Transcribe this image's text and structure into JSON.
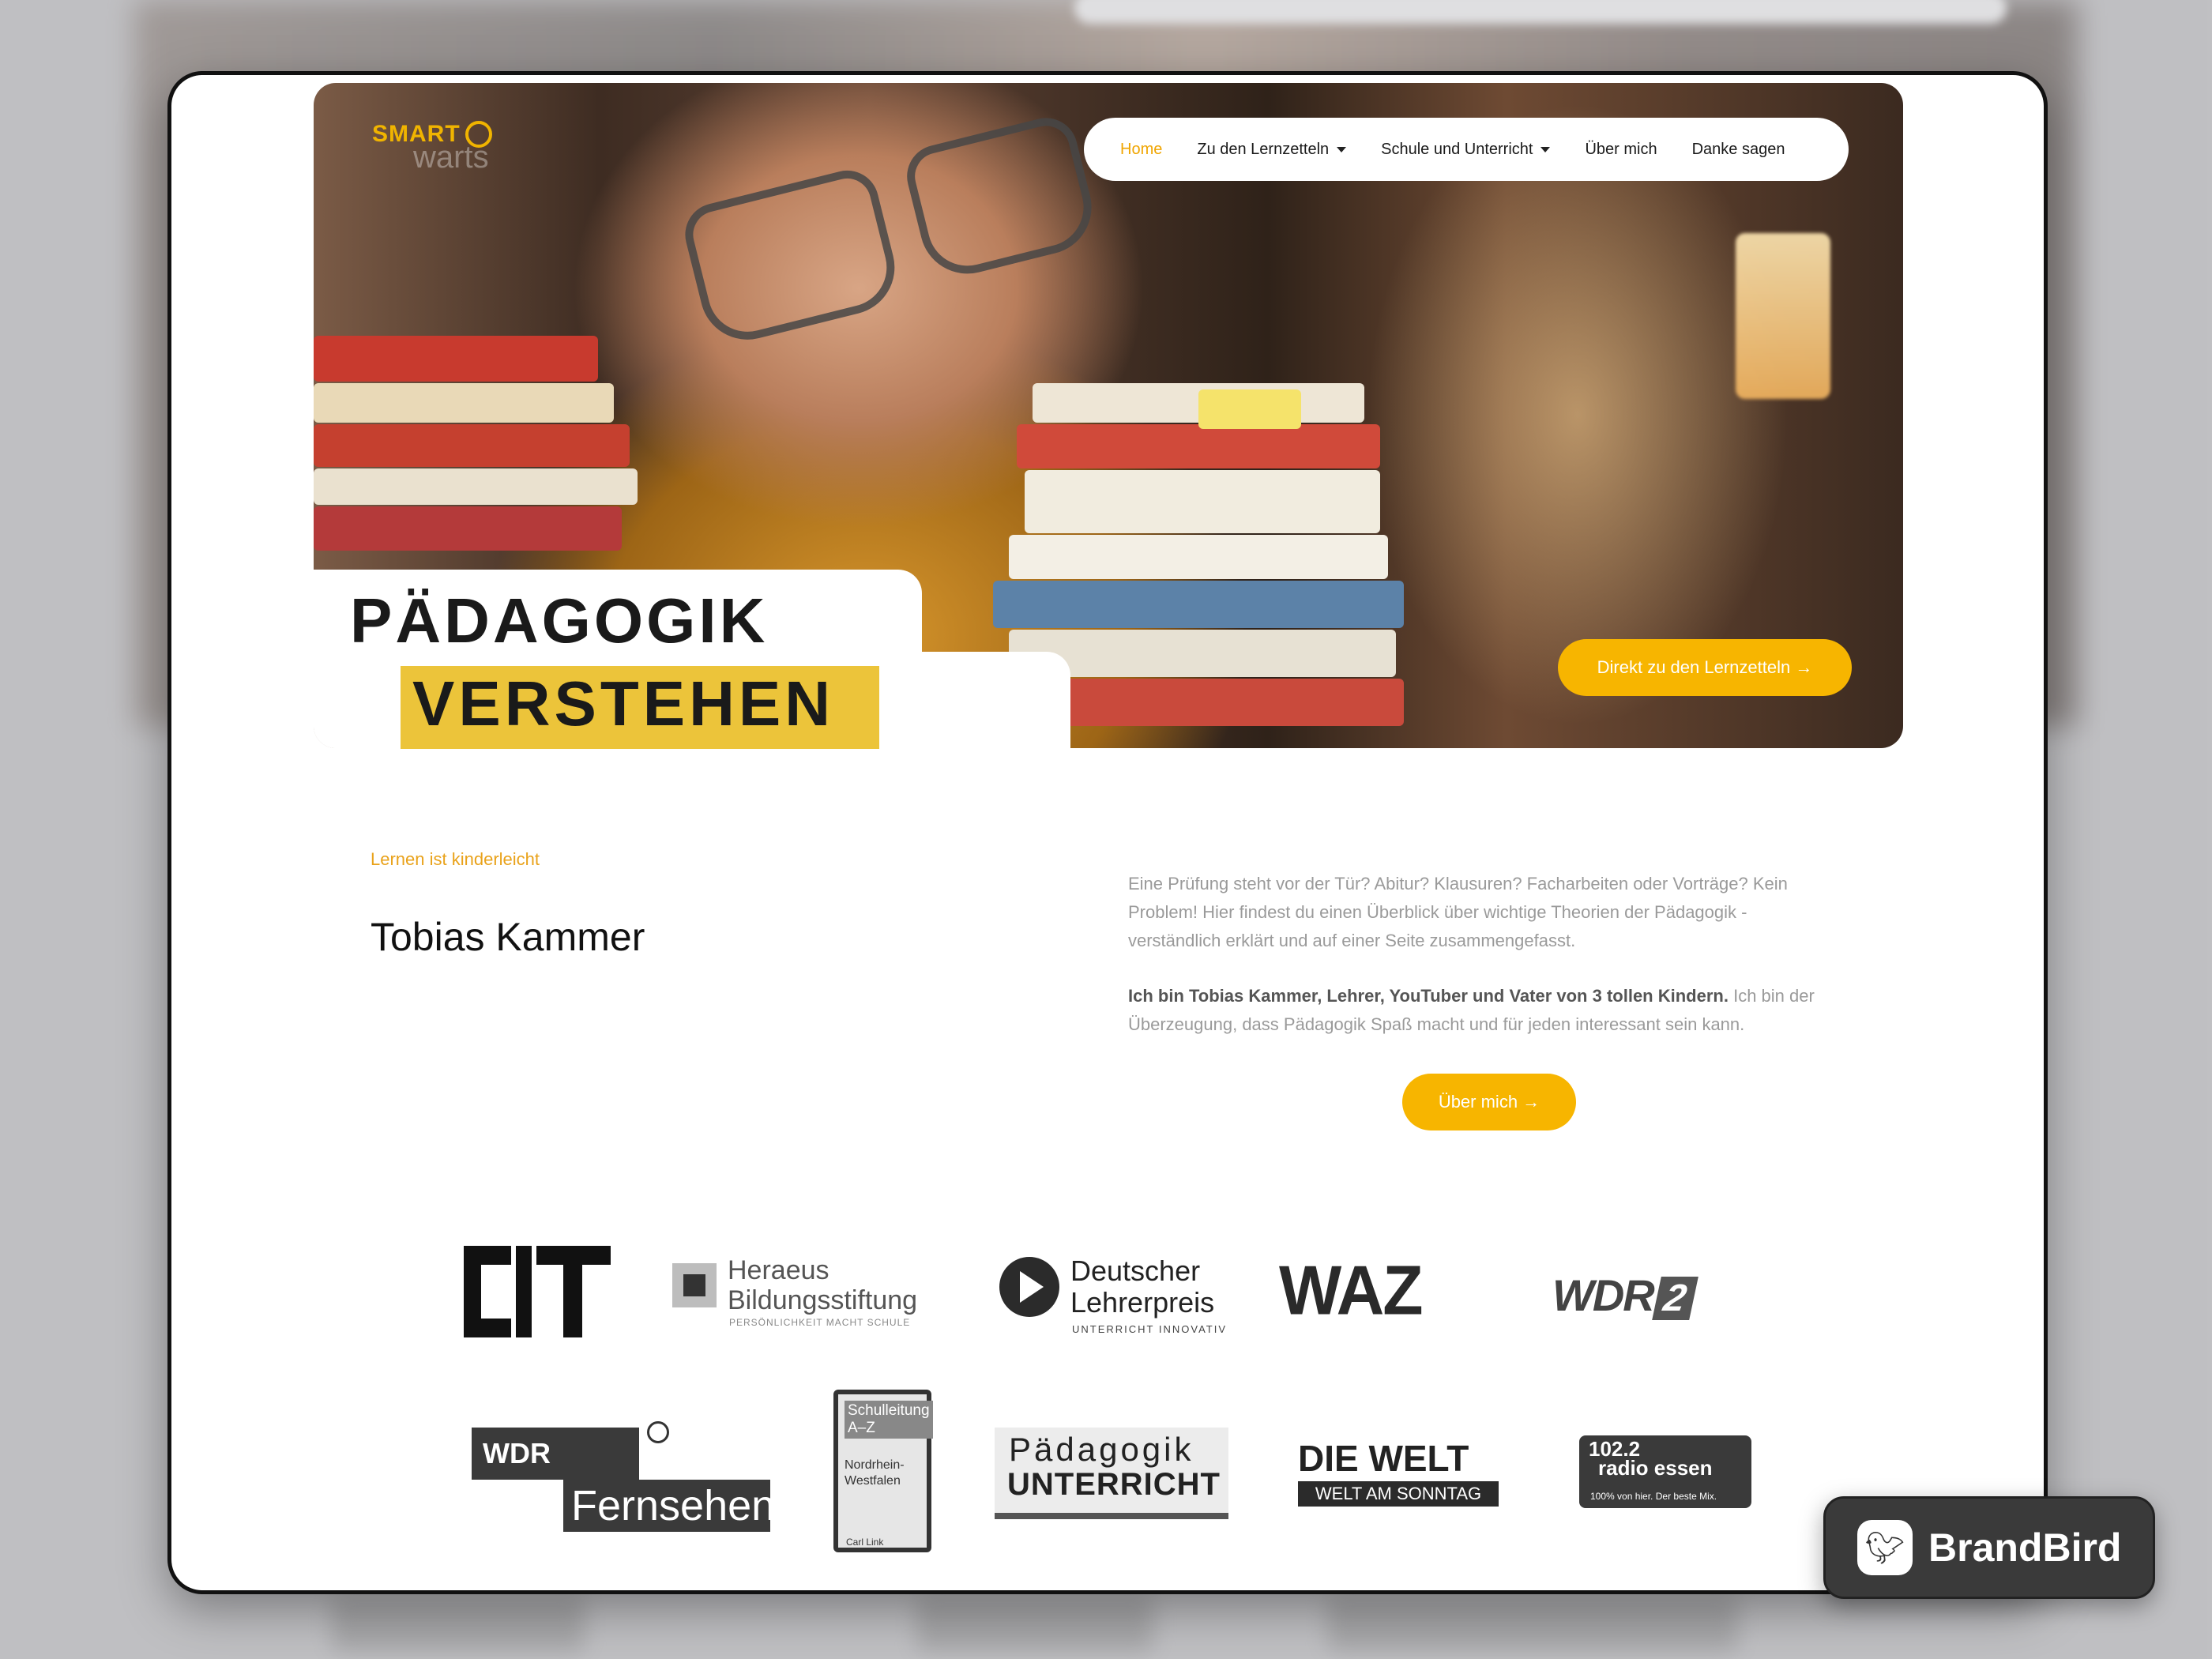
{
  "brand": {
    "logo_smart": "SMART",
    "logo_warts": "warts",
    "accent": "#f7b500"
  },
  "nav": {
    "items": [
      {
        "label": "Home",
        "active": true,
        "dropdown": false
      },
      {
        "label": "Zu den Lernzetteln",
        "active": false,
        "dropdown": true
      },
      {
        "label": "Schule und Unterricht",
        "active": false,
        "dropdown": true
      },
      {
        "label": "Über mich",
        "active": false,
        "dropdown": false
      },
      {
        "label": "Danke sagen",
        "active": false,
        "dropdown": false
      }
    ]
  },
  "hero": {
    "headline_line1": "PÄDAGOGIK",
    "headline_line2": "VERSTEHEN",
    "cta_label": "Direkt zu den Lernzetteln →"
  },
  "intro": {
    "eyebrow": "Lernen ist kinderleicht",
    "name": "Tobias Kammer",
    "paragraph1": "Eine Prüfung steht vor der Tür? Abitur? Klausuren? Facharbeiten oder Vorträge? Kein Problem! Hier findest du einen Überblick über wichtige Theorien der Pädagogik - verständlich erklärt und auf einer Seite zusammengefasst.",
    "paragraph2_bold": "Ich bin Tobias Kammer, Lehrer, YouTuber und Vater von 3 tollen Kindern.",
    "paragraph2_rest": " Ich bin der Überzeugung, dass Pädagogik Spaß macht und für jeden interessant sein kann.",
    "cta_label": "Über mich →"
  },
  "press_logos": {
    "heraeus_line1": "Heraeus",
    "heraeus_line2": "Bildungsstiftung",
    "heraeus_tagline": "PERSÖNLICHKEIT MACHT SCHULE",
    "dlp_line1": "Deutscher",
    "dlp_line2": "Lehrerpreis",
    "dlp_tagline": "UNTERRICHT INNOVATIV",
    "waz": "WAZ",
    "wdr2_text": "WDR",
    "wdr2_num": "2",
    "wdr_fern_top": "WDR",
    "wdr_fern_bottom": "Fernsehen",
    "book_title": "Schulleitung A–Z",
    "book_region": "Nordrhein-Westfalen",
    "book_publisher": "Carl Link",
    "pu_line1": "Pädagogik",
    "pu_line2": "UNTERRICHT",
    "welt_line1": "DIE WELT",
    "welt_line2": "WELT AM SONNTAG",
    "radio_line1": "102.2",
    "radio_line2": "radio essen",
    "radio_tagline": "100% von hier. Der beste Mix."
  },
  "badge": {
    "label": "BrandBird"
  }
}
